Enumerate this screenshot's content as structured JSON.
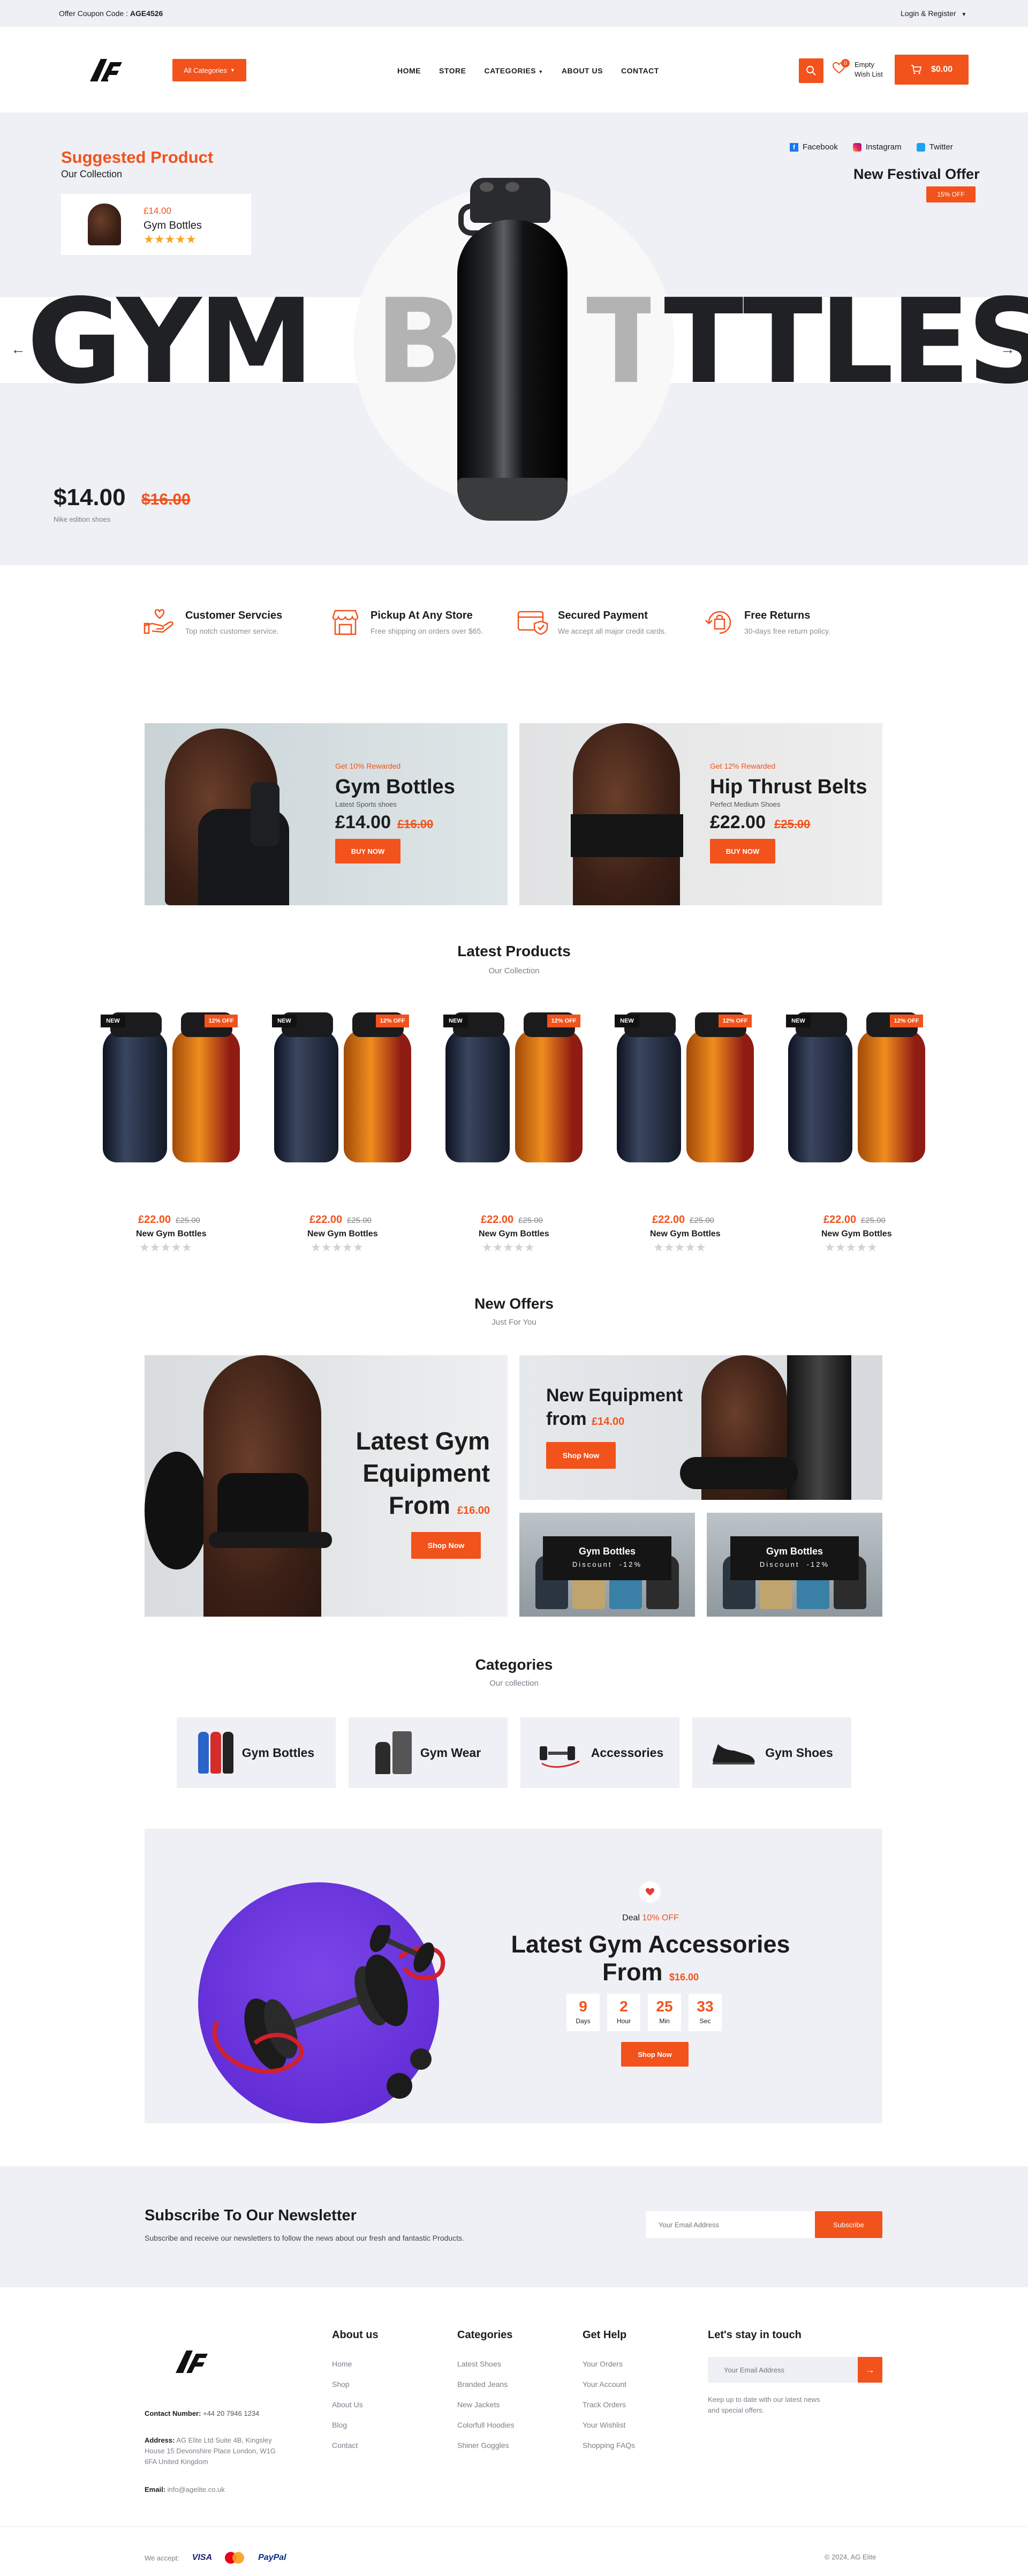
{
  "topbar": {
    "coupon_label": "Offer Coupon Code :",
    "coupon_code": "AGE4526",
    "login": "Login & Register"
  },
  "header": {
    "logo_text": "AG",
    "all_categories": "All Categories",
    "nav": [
      "HOME",
      "STORE",
      "CATEGORIES",
      "ABOUT US",
      "CONTACT"
    ],
    "wishlist_count": "0",
    "wishlist_line1": "Empty",
    "wishlist_line2": "Wish List",
    "cart_total": "$0.00"
  },
  "hero": {
    "suggested_title": "Suggested Product",
    "suggested_sub": "Our Collection",
    "card_price": "£14.00",
    "card_name": "Gym Bottles",
    "social": [
      "Facebook",
      "Instagram",
      "Twitter"
    ],
    "festival_title": "New Festival Offer",
    "festival_badge": "15% OFF",
    "big_word_1": "GYM",
    "big_word_2": "B",
    "big_word_3": "TTLES",
    "price_now": "$14.00",
    "price_old": "$16.00",
    "price_note": "Nike edition shoes"
  },
  "features": [
    {
      "title": "Customer Servcies",
      "sub": "Top notch customer service.",
      "icon": "hand-heart-icon"
    },
    {
      "title": "Pickup At Any Store",
      "sub": "Free shipping on orders over $65.",
      "icon": "store-icon"
    },
    {
      "title": "Secured Payment",
      "sub": "We accept all major credit cards.",
      "icon": "secure-card-icon"
    },
    {
      "title": "Free Returns",
      "sub": "30-days free return policy.",
      "icon": "return-bag-icon"
    }
  ],
  "promos": [
    {
      "tag": "Get 10% Rewarded",
      "title": "Gym Bottles",
      "sub": "Latest Sports shoes",
      "price": "£14.00",
      "old": "£16.00",
      "cta": "BUY NOW"
    },
    {
      "tag": "Get 12% Rewarded",
      "title": "Hip Thrust Belts",
      "sub": "Perfect Medium Shoes",
      "price": "£22.00",
      "old": "£25.00",
      "cta": "BUY NOW"
    }
  ],
  "latest": {
    "title": "Latest Products",
    "sub": "Our Collection",
    "new_badge": "NEW",
    "off_badge": "12% OFF",
    "products": [
      {
        "price": "£22.00",
        "old": "£25.00",
        "name": "New Gym Bottles"
      },
      {
        "price": "£22.00",
        "old": "£25.00",
        "name": "New Gym Bottles"
      },
      {
        "price": "£22.00",
        "old": "£25.00",
        "name": "New Gym Bottles"
      },
      {
        "price": "£22.00",
        "old": "£25.00",
        "name": "New Gym Bottles"
      },
      {
        "price": "£22.00",
        "old": "£25.00",
        "name": "New Gym Bottles"
      }
    ]
  },
  "offers": {
    "title": "New Offers",
    "sub": "Just For You",
    "big_line1": "Latest Gym",
    "big_line2": "Equipment",
    "big_line3": "From",
    "big_price": "£16.00",
    "big_cta": "Shop Now",
    "eq_line1": "New Equipment",
    "eq_line2": "from",
    "eq_price": "£14.00",
    "eq_cta": "Shop Now",
    "small_title": "Gym Bottles",
    "small_sub": "Discount  -12%"
  },
  "categories": {
    "title": "Categories",
    "sub": "Our collection",
    "items": [
      "Gym Bottles",
      "Gym Wear",
      "Accessories",
      "Gym Shoes"
    ]
  },
  "deal": {
    "label": "Deal",
    "percent": "10% OFF",
    "title_line1": "Latest Gym Accessories",
    "title_line2": "From",
    "price": "$16.00",
    "countdown": [
      {
        "value": "9",
        "unit": "Days"
      },
      {
        "value": "2",
        "unit": "Hour"
      },
      {
        "value": "25",
        "unit": "Min"
      },
      {
        "value": "33",
        "unit": "Sec"
      }
    ],
    "cta": "Shop Now"
  },
  "newsletter": {
    "title": "Subscribe To Our Newsletter",
    "sub": "Subscribe and receive our newsletters to follow the news about our fresh and fantastic Products.",
    "placeholder": "Your Email Address",
    "cta": "Subscribe"
  },
  "footer": {
    "contact_label": "Contact Number:",
    "contact_value": "+44 20 7946 1234",
    "address_label": "Address:",
    "address_value": "AG Elite Ltd Suite 4B, Kingsley House 15 Devonshire Place London, W1G 6FA United Kingdom",
    "email_label": "Email:",
    "email_value": "info@agelite.co.uk",
    "cols": [
      {
        "title": "About us",
        "links": [
          "Home",
          "Shop",
          "About Us",
          "Blog",
          "Contact"
        ]
      },
      {
        "title": "Categories",
        "links": [
          "Latest Shoes",
          "Branded Jeans",
          "New Jackets",
          "Colorfull Hoodies",
          "Shiner Goggles"
        ]
      },
      {
        "title": "Get Help",
        "links": [
          "Your Orders",
          "Your Account",
          "Track Orders",
          "Your Wishlist",
          "Shopping FAQs"
        ]
      }
    ],
    "stay_title": "Let's stay in touch",
    "stay_placeholder": "Your Email Address",
    "stay_note": "Keep up to date with our latest news and special offers.",
    "we_accept": "We accept:",
    "payments": [
      "VISA",
      "PayPal"
    ],
    "copyright": "© 2024, AG Elite"
  }
}
